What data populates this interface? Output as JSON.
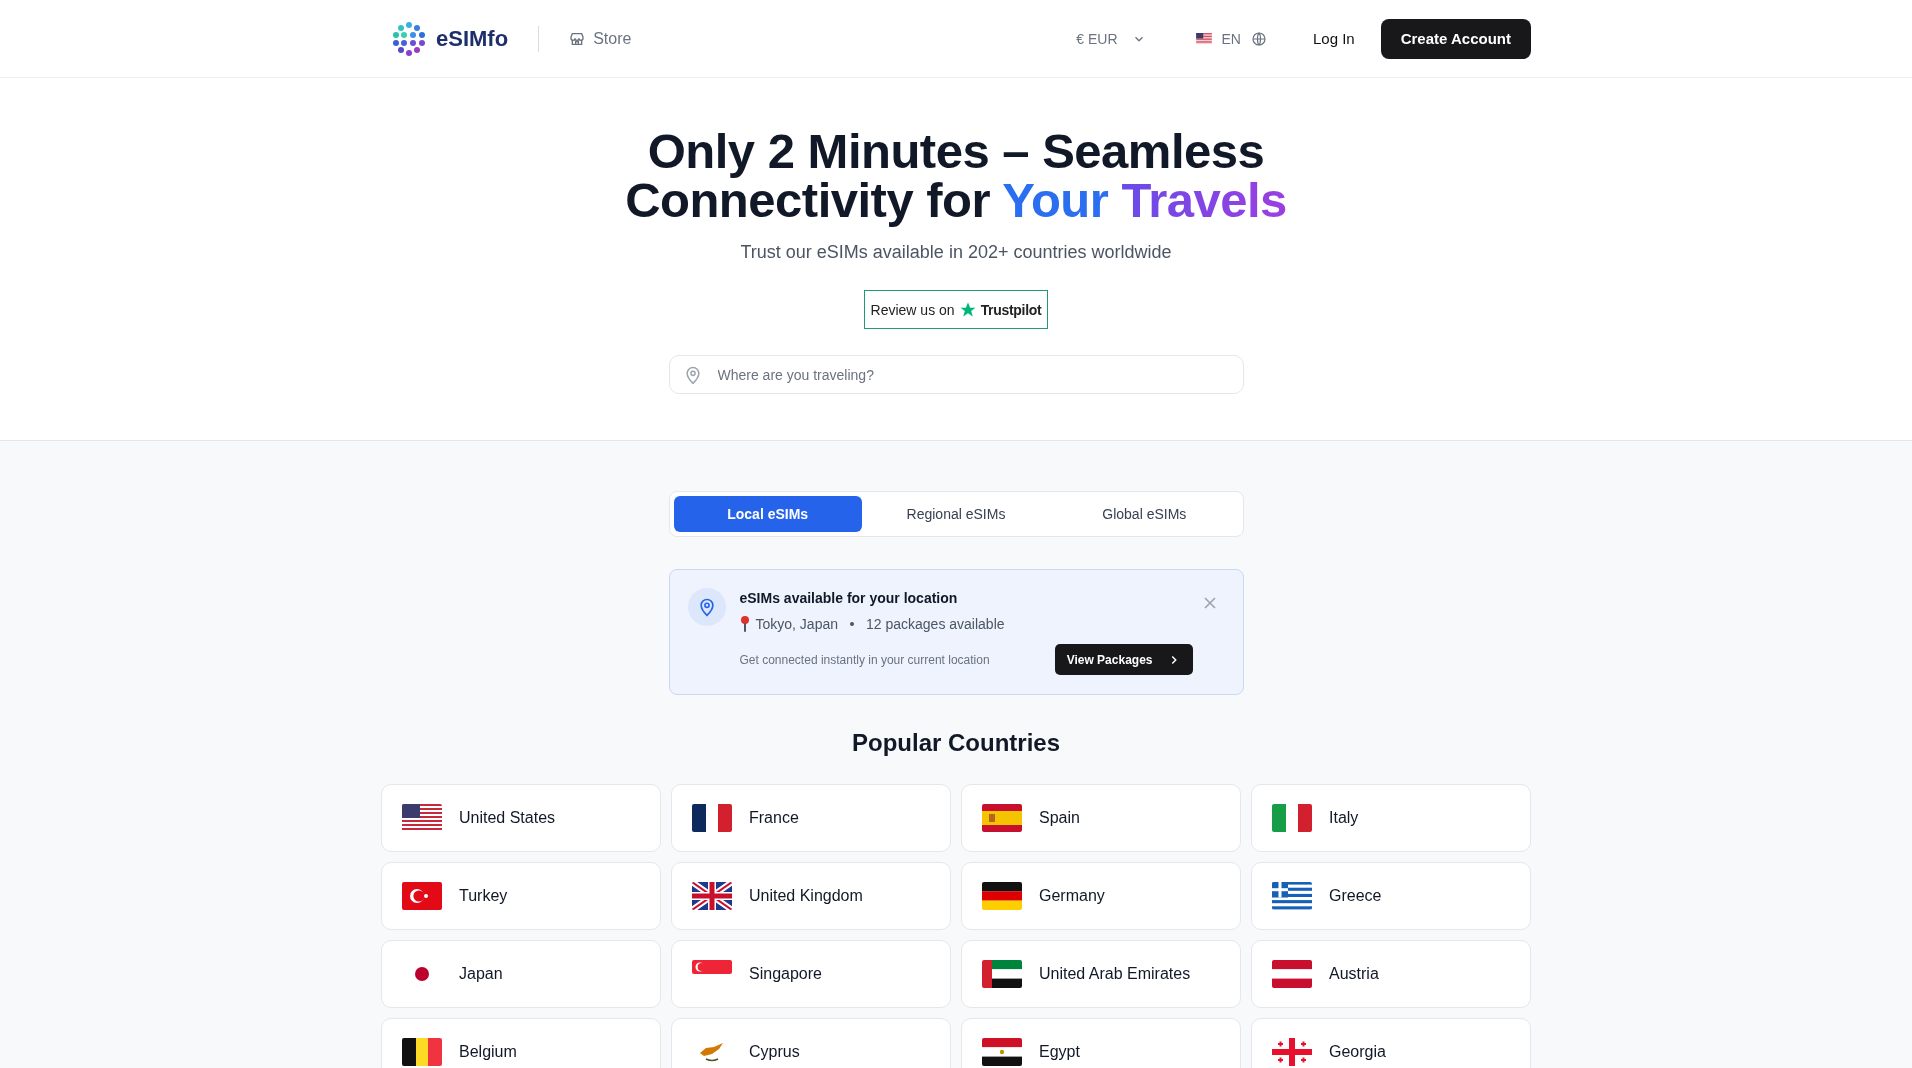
{
  "header": {
    "brand": "eSIMfo",
    "store_link": "Store",
    "currency": "€ EUR",
    "language": "EN",
    "login": "Log In",
    "create_account": "Create Account"
  },
  "hero": {
    "title": "Only 2 Minutes – Seamless Connectivity for",
    "title_highlight_1": "Your",
    "title_highlight_2": "Travels",
    "subtitle": "Trust our eSIMs available in 202+ countries worldwide",
    "review_prefix": "Review us on",
    "review_brand": "Trustpilot",
    "search": {
      "placeholder": "Where are you traveling?"
    }
  },
  "tabs": [
    {
      "label": "Local eSIMs",
      "selected": true
    },
    {
      "label": "Regional eSIMs",
      "selected": false
    },
    {
      "label": "Global eSIMs",
      "selected": false
    }
  ],
  "location_card": {
    "title": "eSIMs available for your location",
    "location": "Tokyo, Japan",
    "packages": "12 packages available",
    "note": "Get connected instantly in your current location",
    "button": "View Packages"
  },
  "popular": {
    "title": "Popular Countries",
    "countries": [
      {
        "name": "United States"
      },
      {
        "name": "France"
      },
      {
        "name": "Spain"
      },
      {
        "name": "Italy"
      },
      {
        "name": "Turkey"
      },
      {
        "name": "United Kingdom"
      },
      {
        "name": "Germany"
      },
      {
        "name": "Greece"
      },
      {
        "name": "Japan"
      },
      {
        "name": "Singapore"
      },
      {
        "name": "United Arab Emirates"
      },
      {
        "name": "Austria"
      },
      {
        "name": "Belgium"
      },
      {
        "name": "Cyprus"
      },
      {
        "name": "Egypt"
      },
      {
        "name": "Georgia"
      }
    ]
  }
}
